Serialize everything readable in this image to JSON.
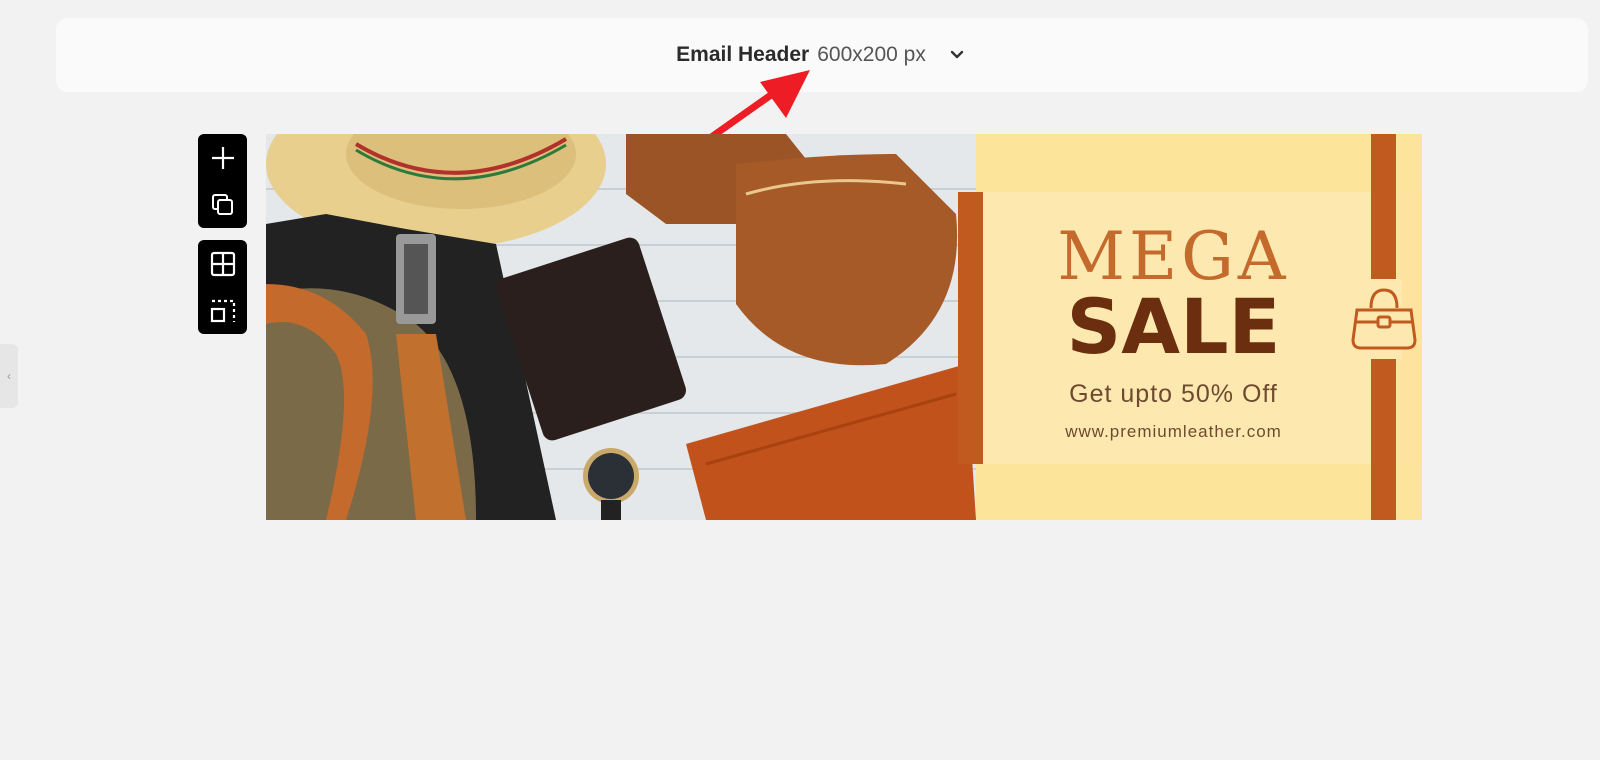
{
  "header": {
    "template_name": "Email Header",
    "template_size": "600x200 px",
    "dropdown_icon": "chevron-down-icon"
  },
  "toolbar": {
    "group1": [
      "plus-icon",
      "duplicate-icon"
    ],
    "group2": [
      "grid-icon",
      "select-area-icon"
    ]
  },
  "banner": {
    "headline1": "MEGA",
    "headline2": "SALE",
    "offer": "Get upto 50% Off",
    "url": "www.premiumleather.com",
    "colors": {
      "accent": "#c05a1f",
      "background": "#fde9b0",
      "headline1": "#c46a2c",
      "headline2": "#6b2f10"
    }
  },
  "annotation": {
    "arrow_color": "#ee1c24"
  }
}
